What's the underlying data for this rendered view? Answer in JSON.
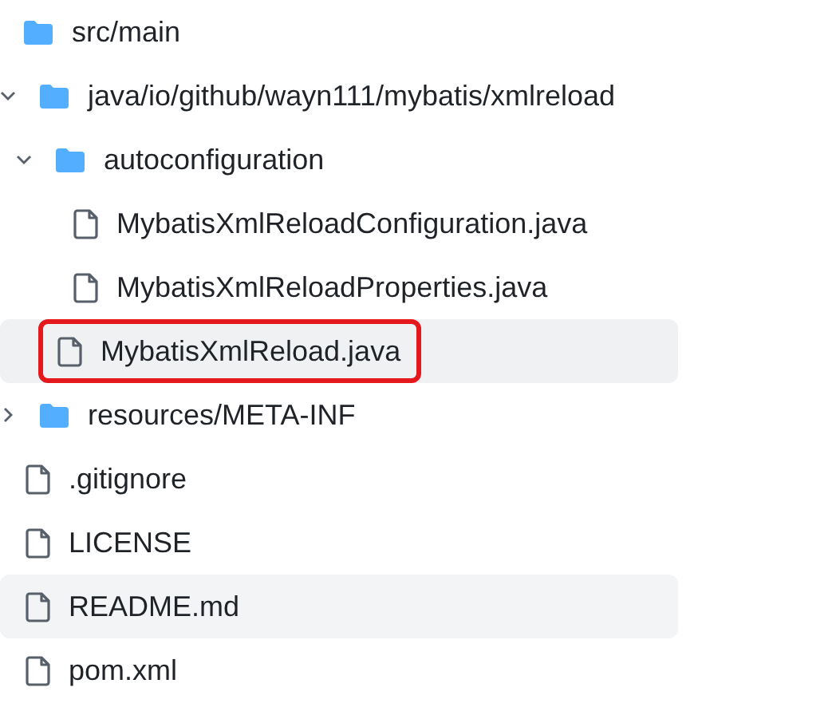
{
  "tree": [
    {
      "name": "src/main",
      "kind": "folder",
      "selected": false,
      "hovered": false,
      "highlighted": false,
      "children": [
        {
          "name": "java/io/github/wayn111/mybatis/xmlreload",
          "kind": "folder",
          "expanded": true,
          "selected": false,
          "hovered": false,
          "highlighted": false,
          "children": [
            {
              "name": "autoconfiguration",
              "kind": "folder",
              "expanded": true,
              "selected": false,
              "hovered": false,
              "highlighted": false,
              "children": [
                {
                  "name": "MybatisXmlReloadConfiguration.java",
                  "kind": "file",
                  "selected": false,
                  "hovered": false,
                  "highlighted": false
                },
                {
                  "name": "MybatisXmlReloadProperties.java",
                  "kind": "file",
                  "selected": false,
                  "hovered": false,
                  "highlighted": false
                }
              ]
            },
            {
              "name": "MybatisXmlReload.java",
              "kind": "file",
              "selected": true,
              "hovered": false,
              "highlighted": true
            }
          ]
        },
        {
          "name": "resources/META-INF",
          "kind": "folder",
          "expanded": false,
          "selected": false,
          "hovered": false,
          "highlighted": false
        }
      ]
    },
    {
      "name": ".gitignore",
      "kind": "file",
      "selected": false,
      "hovered": false,
      "highlighted": false
    },
    {
      "name": "LICENSE",
      "kind": "file",
      "selected": false,
      "hovered": false,
      "highlighted": false
    },
    {
      "name": "README.md",
      "kind": "file",
      "selected": false,
      "hovered": true,
      "highlighted": false
    },
    {
      "name": "pom.xml",
      "kind": "file",
      "selected": false,
      "hovered": false,
      "highlighted": false
    }
  ]
}
